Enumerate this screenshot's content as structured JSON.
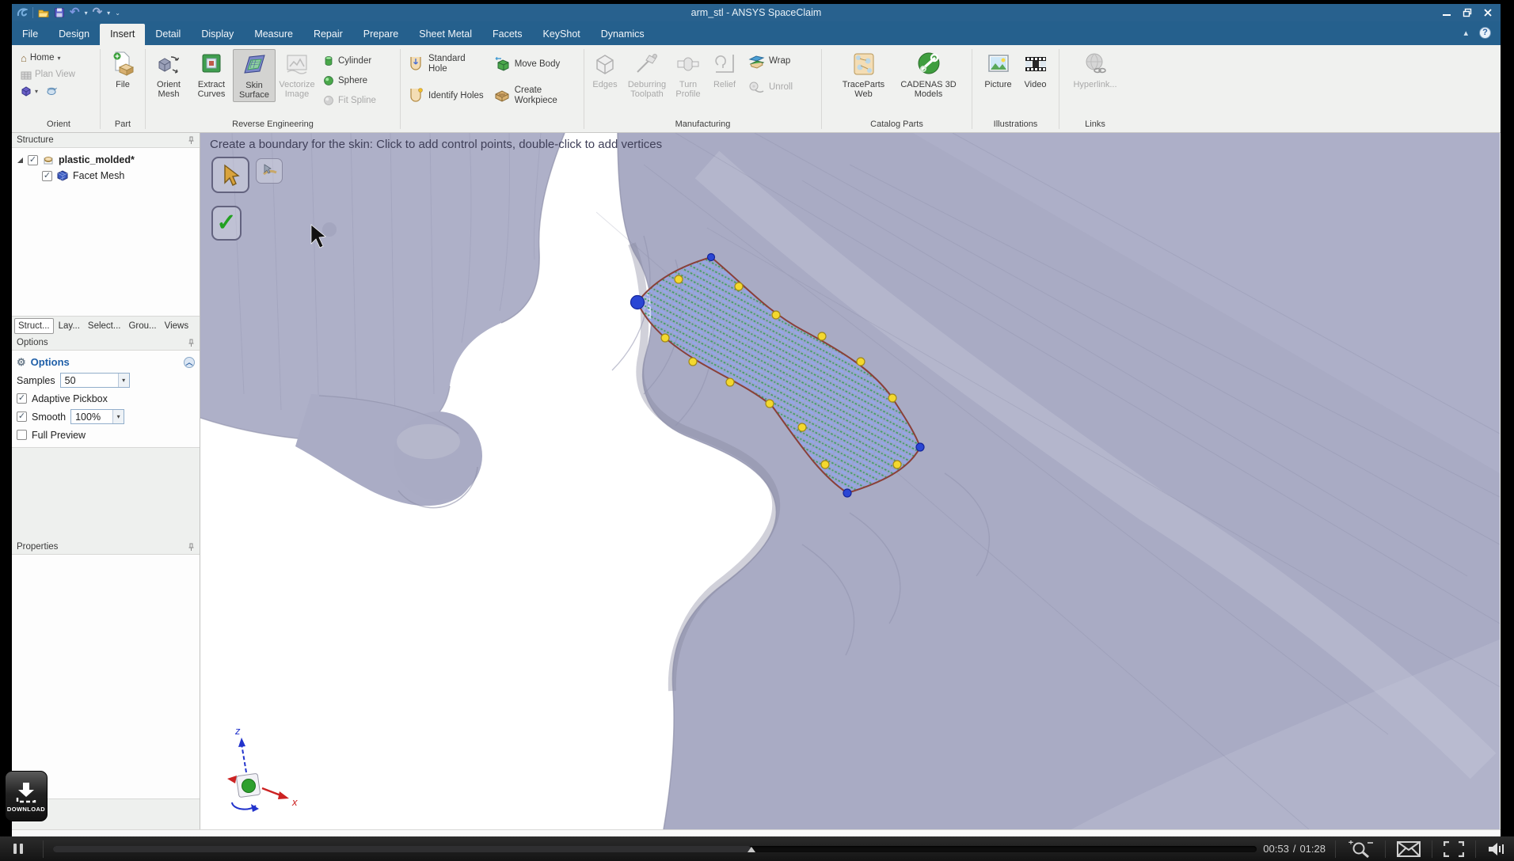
{
  "window": {
    "title": "arm_stl - ANSYS SpaceClaim"
  },
  "menu": {
    "active_tab": "Insert",
    "tabs": [
      {
        "label": "File"
      },
      {
        "label": "Design"
      },
      {
        "label": "Insert"
      },
      {
        "label": "Detail"
      },
      {
        "label": "Display"
      },
      {
        "label": "Measure"
      },
      {
        "label": "Repair"
      },
      {
        "label": "Prepare"
      },
      {
        "label": "Sheet Metal"
      },
      {
        "label": "Facets"
      },
      {
        "label": "KeyShot"
      },
      {
        "label": "Dynamics"
      }
    ]
  },
  "ribbon": {
    "orient": {
      "label": "Orient",
      "home": "Home",
      "plan_view": "Plan View"
    },
    "part": {
      "label": "Part",
      "file": "File"
    },
    "reverse_engineering": {
      "label": "Reverse Engineering",
      "orient_mesh": "Orient Mesh",
      "extract_curves": "Extract Curves",
      "skin_surface": "Skin Surface",
      "vectorize_image": "Vectorize Image",
      "cylinder": "Cylinder",
      "sphere": "Sphere",
      "fit_spline": "Fit Spline"
    },
    "insert": {
      "label": "",
      "standard_hole": "Standard Hole",
      "identify_holes": "Identify Holes",
      "move_body": "Move Body",
      "create_workpiece": "Create Workpiece"
    },
    "manufacturing": {
      "label": "Manufacturing",
      "edges": "Edges",
      "deburring_toolpath": "Deburring Toolpath",
      "turn_profile": "Turn Profile",
      "relief": "Relief",
      "wrap": "Wrap",
      "unroll": "Unroll"
    },
    "catalog_parts": {
      "label": "Catalog Parts",
      "traceparts_web": "TraceParts Web",
      "cadenas_3d_models": "CADENAS 3D Models"
    },
    "illustrations": {
      "label": "Illustrations",
      "picture": "Picture",
      "video": "Video"
    },
    "links": {
      "label": "Links",
      "hyperlink": "Hyperlink..."
    }
  },
  "panels": {
    "structure": {
      "header": "Structure",
      "root_item": "plastic_molded*",
      "child_item": "Facet Mesh"
    },
    "tabs": [
      {
        "label": "Struct..."
      },
      {
        "label": "Lay..."
      },
      {
        "label": "Select..."
      },
      {
        "label": "Grou..."
      },
      {
        "label": "Views"
      }
    ],
    "options": {
      "header": "Options",
      "group_title": "Options",
      "samples_label": "Samples",
      "samples_value": "50",
      "adaptive_pickbox_label": "Adaptive Pickbox",
      "adaptive_pickbox_checked": true,
      "smooth_label": "Smooth",
      "smooth_value": "100%",
      "smooth_checked": true,
      "full_preview_label": "Full Preview",
      "full_preview_checked": false
    },
    "properties": {
      "header": "Properties"
    }
  },
  "viewport": {
    "prompt": "Create a boundary for the skin: Click to add control points, double-click to add vertices",
    "triad_z_label": "z",
    "triad_x_label": "x"
  },
  "player": {
    "current_time": "00:53",
    "time_separator": "/",
    "duration": "01:28",
    "progress_percent": 58,
    "download_label": "DOWNLOAD"
  },
  "icons": {
    "dropdown_glyph": "▾",
    "undo_glyph": "↶",
    "redo_glyph": "↷",
    "qat_more_glyph": "⌄",
    "help_glyph": "?",
    "gear_glyph": "⚙",
    "check_glyph": "✓",
    "home_glyph": "⌂",
    "collapse_ribbon_glyph": "▴",
    "collapse_panel_glyph": "︿"
  },
  "colors": {
    "titlebar_blue": "#28618e",
    "ribbon_bg": "#f0f1ef",
    "panel_bg": "#eef0ee",
    "mesh_lavender": "#a9abc4",
    "patch_boundary_red": "#8a4038",
    "control_point_yellow": "#f3d82e",
    "control_point_blue": "#2a46d4",
    "sample_line_green": "#3f9e5f",
    "player_bar_black": "#1b1b1b"
  }
}
